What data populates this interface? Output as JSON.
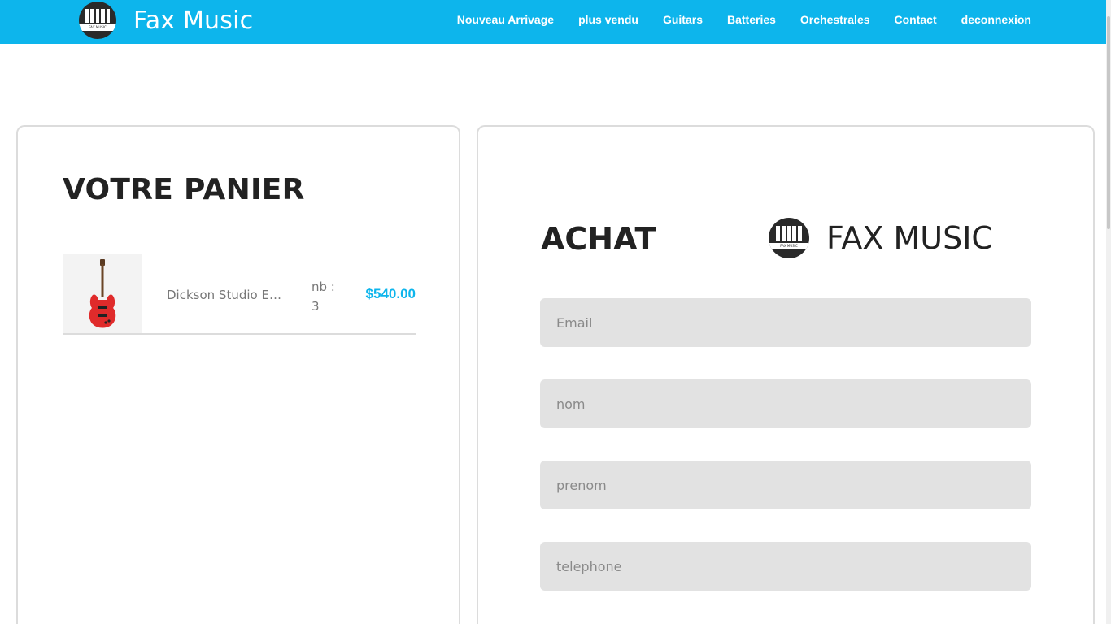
{
  "header": {
    "brand": "Fax Music",
    "logo_text": "FAX MUSIC",
    "nav": [
      {
        "label": "Nouveau Arrivage"
      },
      {
        "label": "plus vendu"
      },
      {
        "label": "Guitars"
      },
      {
        "label": "Batteries"
      },
      {
        "label": "Orchestrales"
      },
      {
        "label": "Contact"
      },
      {
        "label": "deconnexion"
      }
    ]
  },
  "cart": {
    "title": "VOTRE PANIER",
    "items": [
      {
        "name": "Dickson Studio ER…",
        "qty": "nb : 3",
        "price": "$540.00",
        "image": "red-electric-guitar"
      }
    ]
  },
  "purchase": {
    "title": "ACHAT",
    "brand": "FAX MUSIC",
    "logo_text": "FAX MUSIC",
    "fields": {
      "email": {
        "placeholder": "Email"
      },
      "nom": {
        "placeholder": "nom"
      },
      "prenom": {
        "placeholder": "prenom"
      },
      "telephone": {
        "placeholder": "telephone"
      }
    }
  },
  "colors": {
    "accent": "#0db5ec",
    "field_bg": "#e2e2e2"
  }
}
